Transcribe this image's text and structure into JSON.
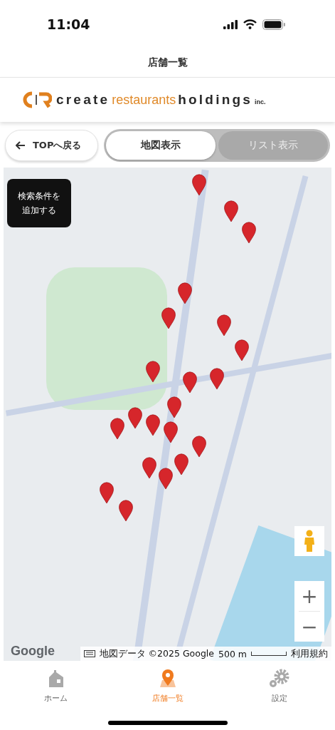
{
  "status_bar": {
    "time": "11:04"
  },
  "header": {
    "title": "店舗一覧"
  },
  "logo": {
    "parts": [
      {
        "text": "create",
        "kind": "dark"
      },
      {
        "text": "restaurants",
        "kind": "accent"
      },
      {
        "text": "holdings",
        "kind": "dark"
      },
      {
        "text": "inc.",
        "kind": "small"
      }
    ]
  },
  "back_button": {
    "label": "TOPへ戻る"
  },
  "view_toggle": [
    {
      "label": "地図表示",
      "selected": true
    },
    {
      "label": "リスト表示",
      "selected": false
    }
  ],
  "map": {
    "filter_button": "検索条件を追加する",
    "google_logo": "Google",
    "attribution": "地図データ ©2025 Google",
    "scale": "500 m",
    "terms": "利用規約",
    "zoom_in": "+",
    "zoom_out": "−"
  },
  "tab_bar": [
    {
      "label": "ホーム",
      "kind": "home",
      "selected": false
    },
    {
      "label": "店舗一覧",
      "kind": "pin",
      "selected": true
    },
    {
      "label": "設定",
      "kind": "gear",
      "selected": false
    }
  ]
}
